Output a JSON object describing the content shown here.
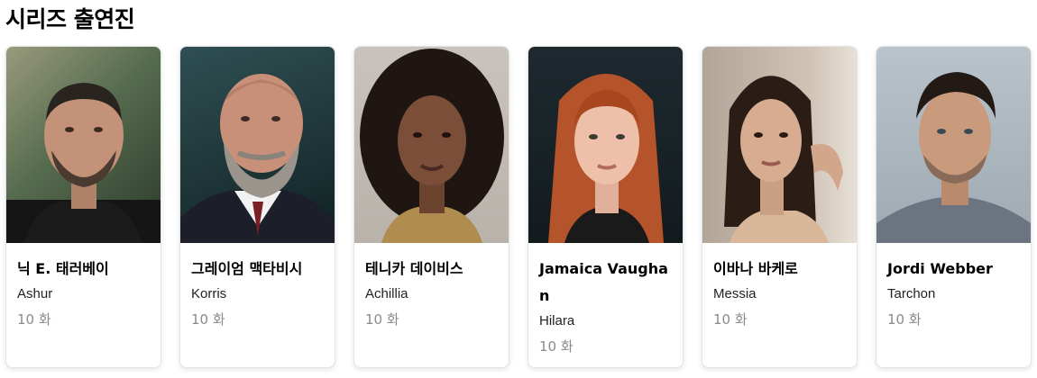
{
  "section": {
    "title": "시리즈 출연진"
  },
  "cast": [
    {
      "actor": "닉 E. 태러베이",
      "role": "Ashur",
      "episodes": "10 화",
      "photo_icon": "person-portrait-icon"
    },
    {
      "actor": "그레이엄 맥타비시",
      "role": "Korris",
      "episodes": "10 화",
      "photo_icon": "person-portrait-icon"
    },
    {
      "actor": "테니카 데이비스",
      "role": "Achillia",
      "episodes": "10 화",
      "photo_icon": "person-portrait-icon"
    },
    {
      "actor": "Jamaica Vaughan",
      "role": "Hilara",
      "episodes": "10 화",
      "photo_icon": "person-portrait-icon"
    },
    {
      "actor": "이바나 바케로",
      "role": "Messia",
      "episodes": "10 화",
      "photo_icon": "person-portrait-icon"
    },
    {
      "actor": "Jordi Webber",
      "role": "Tarchon",
      "episodes": "10 화",
      "photo_icon": "person-portrait-icon"
    }
  ]
}
